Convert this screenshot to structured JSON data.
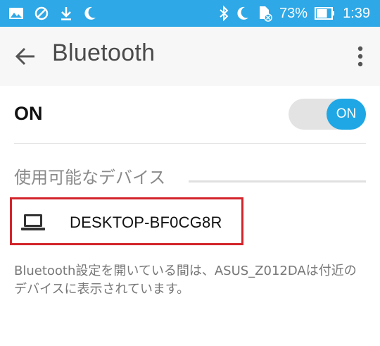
{
  "status_bar": {
    "left_icons": [
      "gallery-icon",
      "blocked-icon",
      "download-icon",
      "moon-icon"
    ],
    "right_icons": [
      "bluetooth-icon",
      "moon-icon",
      "sd-card-icon"
    ],
    "battery_percent": "73%",
    "battery_level": 0.73,
    "time": "1:39",
    "color": "#2ea8e6"
  },
  "app_bar": {
    "title": "Bluetooth",
    "back_icon": "arrow-back-icon",
    "menu_icon": "more-vert-icon"
  },
  "bluetooth_toggle": {
    "label": "ON",
    "switch_text": "ON",
    "enabled": true,
    "accent_color": "#1ea7e4"
  },
  "available_devices": {
    "title": "使用可能なデバイス",
    "devices": [
      {
        "name": "DESKTOP-BF0CG8R",
        "icon": "laptop-icon",
        "highlight_color": "#d3242b"
      }
    ]
  },
  "info": {
    "text": "Bluetooth設定を開いている間は、ASUS_Z012DAは付近のデバイスに表示されています。"
  }
}
